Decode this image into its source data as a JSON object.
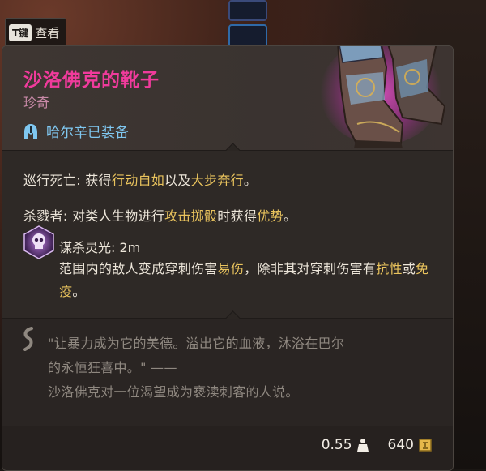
{
  "toggle": {
    "key": "T键",
    "label": "查看"
  },
  "item": {
    "name": "沙洛佛克的靴子",
    "rarity": "珍奇",
    "equipped_by": "哈尔辛已装备"
  },
  "properties": [
    {
      "label": "巡行死亡:",
      "segments": [
        {
          "text": " 获得",
          "hl": false
        },
        {
          "text": "行动自如",
          "hl": true
        },
        {
          "text": "以及",
          "hl": false
        },
        {
          "text": "大步奔行",
          "hl": true
        },
        {
          "text": "。",
          "hl": false
        }
      ]
    },
    {
      "label": "杀戮者:",
      "segments": [
        {
          "text": " 对类人生物进行",
          "hl": false
        },
        {
          "text": "攻击掷骰",
          "hl": true
        },
        {
          "text": "时获得",
          "hl": false
        },
        {
          "text": "优势",
          "hl": true
        },
        {
          "text": "。",
          "hl": false
        }
      ]
    }
  ],
  "aura": {
    "title": "谋杀灵光: 2m",
    "segments": [
      {
        "text": "范围内的敌人变成穿刺伤害",
        "hl": false
      },
      {
        "text": "易伤",
        "hl": true
      },
      {
        "text": "，除非其对穿刺伤害有",
        "hl": false
      },
      {
        "text": "抗性",
        "hl": true
      },
      {
        "text": "或",
        "hl": false
      },
      {
        "text": "免疫",
        "hl": true
      },
      {
        "text": "。",
        "hl": false
      }
    ]
  },
  "lore": {
    "quote_line1": "\"让暴力成为它的美德。溢出它的血液，沐浴在巴尔",
    "quote_line2": "的永恒狂喜中。\" ——",
    "attribution": "沙洛佛克对一位渴望成为亵渎刺客的人说。"
  },
  "footer": {
    "weight": "0.55",
    "price": "640"
  },
  "icons": {
    "equip": "helmet-icon",
    "aura": "skull-aura-icon",
    "lore": "lore-scroll-icon",
    "weight": "weight-icon",
    "price": "gold-coin-icon"
  },
  "colors": {
    "name": "#f03b9c",
    "rarity": "#c98aa8",
    "equip": "#7fc7f0",
    "highlight": "#e9c35d",
    "lore": "#8f8880"
  }
}
